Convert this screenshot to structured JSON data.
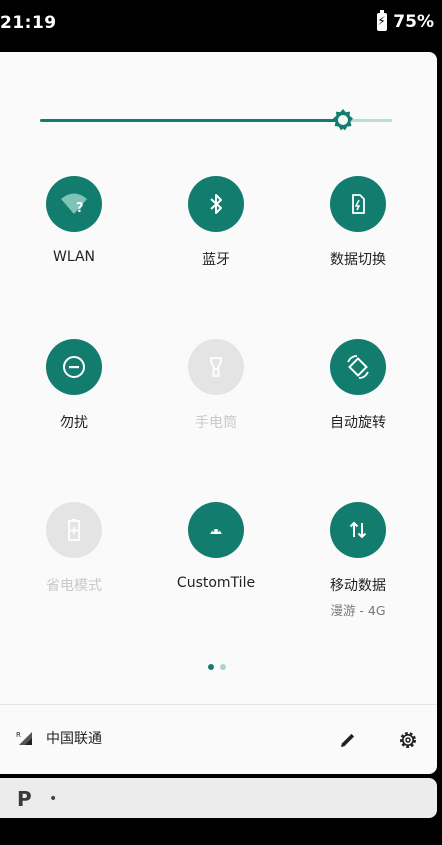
{
  "status_bar": {
    "time": "21:19",
    "battery": "75%"
  },
  "brightness": {
    "level": 0.86
  },
  "tiles": [
    {
      "id": "wlan",
      "label": "WLAN",
      "icon": "wifi-question-icon",
      "state": "on"
    },
    {
      "id": "bluetooth",
      "label": "蓝牙",
      "icon": "bluetooth-icon",
      "state": "on"
    },
    {
      "id": "data-switch",
      "label": "数据切换",
      "icon": "sim-switch-icon",
      "state": "on"
    },
    {
      "id": "dnd",
      "label": "勿扰",
      "icon": "do-not-disturb-icon",
      "state": "on"
    },
    {
      "id": "flashlight",
      "label": "手电筒",
      "icon": "flashlight-icon",
      "state": "off"
    },
    {
      "id": "auto-rotate",
      "label": "自动旋转",
      "icon": "rotate-icon",
      "state": "on"
    },
    {
      "id": "battery-saver",
      "label": "省电模式",
      "icon": "battery-saver-icon",
      "state": "off"
    },
    {
      "id": "custom-tile",
      "label": "CustomTile",
      "icon": "android-icon",
      "state": "on"
    },
    {
      "id": "mobile-data",
      "label": "移动数据",
      "sublabel": "漫游 - 4G",
      "icon": "mobile-data-icon",
      "state": "on"
    }
  ],
  "pager": {
    "pages": 2,
    "current": 1
  },
  "footer": {
    "carrier": "中国联通",
    "signal_badge": "R"
  },
  "notification": {
    "app_letter": "P",
    "bullet": "•"
  },
  "colors": {
    "accent": "#127d6e",
    "inactive": "#e4e4e4",
    "panel": "#fafafa"
  }
}
